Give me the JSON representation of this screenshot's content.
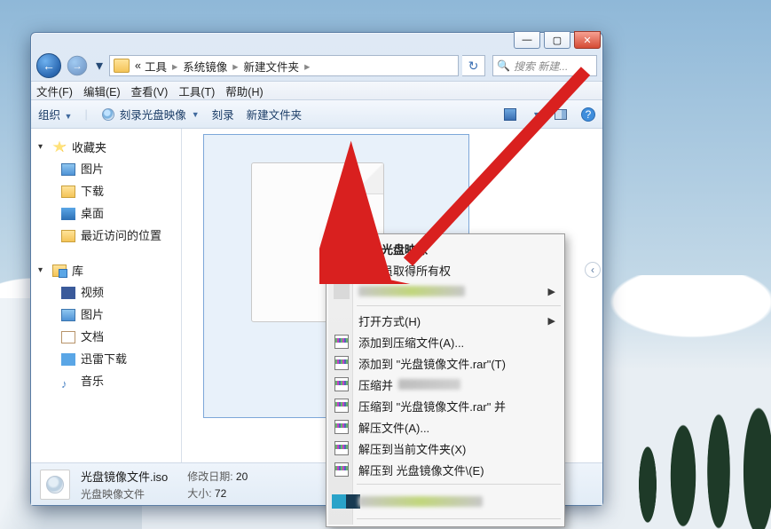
{
  "window": {
    "path": {
      "p1": "工具",
      "p2": "系统镜像",
      "p3": "新建文件夹",
      "prefix": "«"
    },
    "search_placeholder": "搜索 新建..."
  },
  "menus": {
    "file": "文件(F)",
    "edit": "编辑(E)",
    "view": "查看(V)",
    "tools": "工具(T)",
    "help": "帮助(H)"
  },
  "toolbar": {
    "organize": "组织",
    "burn_image": "刻录光盘映像",
    "burn": "刻录",
    "new_folder": "新建文件夹"
  },
  "nav": {
    "favorites": "收藏夹",
    "pictures": "图片",
    "downloads": "下载",
    "desktop": "桌面",
    "recent": "最近访问的位置",
    "libraries": "库",
    "videos": "视频",
    "pictures2": "图片",
    "documents": "文档",
    "thunder": "迅雷下载",
    "music": "音乐"
  },
  "details": {
    "filename": "光盘镜像文件.iso",
    "filetype": "光盘映像文件",
    "mod_label": "修改日期:",
    "mod_value": "20",
    "size_label": "大小:",
    "size_value": "72"
  },
  "context_menu": {
    "burn_image": "刻录光盘映像",
    "admin_own": "管理员取得所有权",
    "open_with": "打开方式(H)",
    "add_archive": "添加到压缩文件(A)...",
    "add_to_rar": "添加到 \"光盘镜像文件.rar\"(T)",
    "compress_and": "压缩并",
    "compress_to_rar": "压缩到 \"光盘镜像文件.rar\" 并",
    "extract": "解压文件(A)...",
    "extract_here": "解压到当前文件夹(X)",
    "extract_to": "解压到 光盘镜像文件\\(E)"
  }
}
